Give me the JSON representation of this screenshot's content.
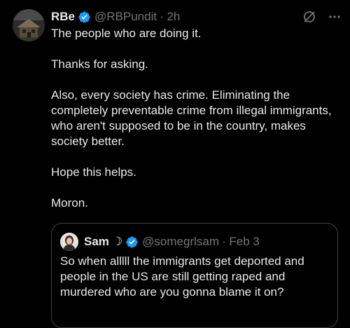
{
  "tweet": {
    "name": "RBe",
    "handle": "@RBPundit",
    "time": "· 2h",
    "paragraphs": [
      "The people who are doing it.",
      "Thanks for asking.",
      "Also, every society has crime. Eliminating the completely preventable crime from illegal immigrants, who aren't supposed to be in the country, makes society better.",
      "Hope this helps.",
      "Moron."
    ]
  },
  "quote": {
    "name": "Sam",
    "moon": "☽",
    "handle": "@somegrlsam",
    "time": "· Feb 3",
    "text": "So when alllll the immigrants get deported and people in the US are still getting raped and murdered who are you gonna blame it on?"
  },
  "colors": {
    "verified": "#1d9bf0",
    "muted": "#71767b",
    "text": "#e7e9ea"
  },
  "icons": [
    "verified-badge-icon",
    "grok-icon",
    "more-icon"
  ]
}
